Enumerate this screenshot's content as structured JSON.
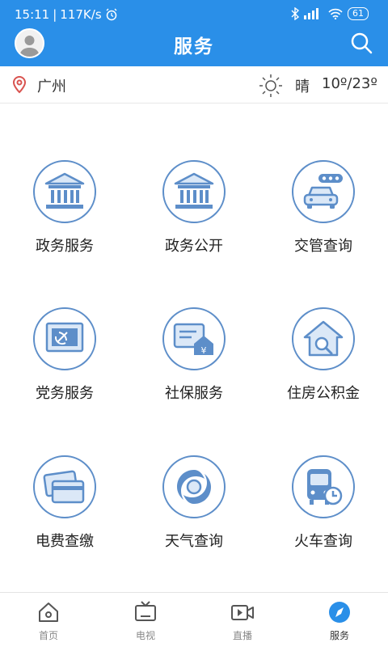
{
  "status_bar": {
    "time": "15:11",
    "speed": "117K/s",
    "battery": "61"
  },
  "header": {
    "title": "服务"
  },
  "weather": {
    "city": "广州",
    "condition": "晴",
    "temperature": "10º/23º"
  },
  "services": [
    {
      "label": "政务服务",
      "icon": "government-building-icon"
    },
    {
      "label": "政务公开",
      "icon": "government-building-icon"
    },
    {
      "label": "交管查询",
      "icon": "car-icon"
    },
    {
      "label": "党务服务",
      "icon": "party-flag-icon"
    },
    {
      "label": "社保服务",
      "icon": "social-security-icon"
    },
    {
      "label": "住房公积金",
      "icon": "house-search-icon"
    },
    {
      "label": "电费查缴",
      "icon": "card-icon"
    },
    {
      "label": "天气查询",
      "icon": "typhoon-icon"
    },
    {
      "label": "火车查询",
      "icon": "train-clock-icon"
    }
  ],
  "tabs": [
    {
      "label": "首页",
      "icon": "home-icon"
    },
    {
      "label": "电视",
      "icon": "tv-icon"
    },
    {
      "label": "直播",
      "icon": "live-video-icon"
    },
    {
      "label": "服务",
      "icon": "compass-icon",
      "active": true
    }
  ],
  "colors": {
    "header_bg": "#2a8fe8",
    "icon_stroke": "#5d8ec9",
    "icon_fill": "#dbe8f7",
    "active_tab": "#2a8fe8"
  }
}
